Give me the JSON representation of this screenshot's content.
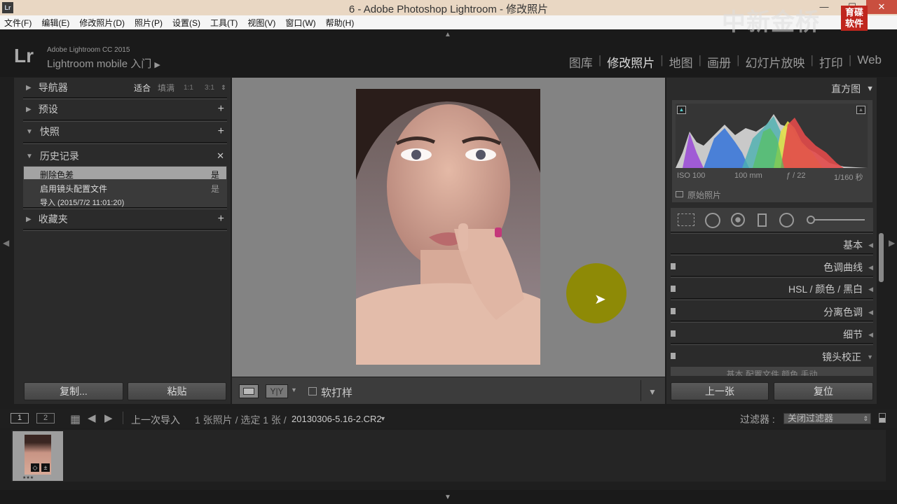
{
  "window": {
    "title": "6 - Adobe Photoshop Lightroom - 修改照片",
    "icon_text": "Lr"
  },
  "menubar": [
    "文件(F)",
    "编辑(E)",
    "修改照片(D)",
    "照片(P)",
    "设置(S)",
    "工具(T)",
    "视图(V)",
    "窗口(W)",
    "帮助(H)"
  ],
  "watermark": {
    "text": "中新金桥",
    "badge": "育碟\n软件"
  },
  "identity": {
    "logo": "Lr",
    "product": "Adobe Lightroom CC 2015",
    "mobile": "Lightroom mobile 入门"
  },
  "modules": [
    "图库",
    "修改照片",
    "地图",
    "画册",
    "幻灯片放映",
    "打印",
    "Web"
  ],
  "active_module": "修改照片",
  "left_panel": {
    "navigator": {
      "label": "导航器",
      "zoom": [
        "适合",
        "填满",
        "1:1",
        "3:1"
      ]
    },
    "presets": "预设",
    "snapshots": "快照",
    "history": {
      "label": "历史记录",
      "items": [
        {
          "name": "删除色差",
          "value": "是"
        },
        {
          "name": "启用镜头配置文件",
          "value": "是"
        },
        {
          "name": "导入 (2015/7/2 11:01:20)",
          "value": ""
        }
      ]
    },
    "collections": "收藏夹",
    "copy_button": "复制...",
    "paste_button": "粘贴"
  },
  "toolbar": {
    "soft_proof": "软打样"
  },
  "right_panel": {
    "histogram": {
      "label": "直方图",
      "iso": "ISO 100",
      "focal": "100 mm",
      "aperture": "ƒ / 22",
      "shutter": "1/160 秒",
      "original": "原始照片"
    },
    "sections": [
      "基本",
      "色调曲线",
      "HSL / 颜色 / 黑白",
      "分离色调",
      "细节",
      "镜头校正"
    ],
    "cut_tabs": "基本  配置文件  颜色  手动",
    "prev_button": "上一张",
    "reset_button": "复位"
  },
  "filmstrip": {
    "pages": [
      "1",
      "2"
    ],
    "source": "上一次导入",
    "count": "1 张照片 / 选定 1 张 /",
    "filename": "20130306-5.16-2.CR2",
    "filter_label": "过滤器 :",
    "filter_value": "关闭过滤器",
    "stars": "★★★"
  }
}
